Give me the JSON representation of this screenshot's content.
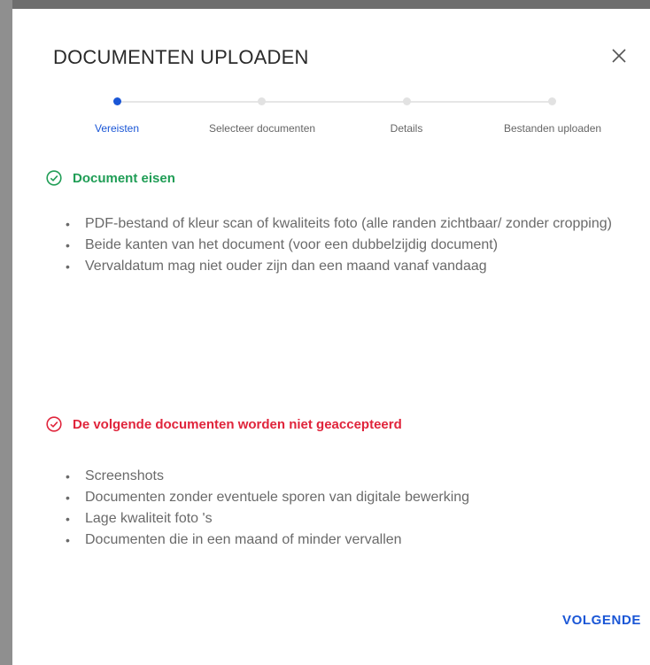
{
  "dialog": {
    "title": "DOCUMENTEN UPLOADEN",
    "close_icon": "close-icon"
  },
  "stepper": {
    "steps": [
      {
        "label": "Vereisten",
        "active": true
      },
      {
        "label": "Selecteer documenten",
        "active": false
      },
      {
        "label": "Details",
        "active": false
      },
      {
        "label": "Bestanden uploaden",
        "active": false
      }
    ]
  },
  "requirements": {
    "heading": "Document eisen",
    "icon": "check-circle-icon",
    "color": "#1f9d55",
    "items": [
      "PDF-bestand of kleur scan of kwaliteits foto (alle randen zichtbaar/ zonder cropping)",
      "Beide kanten van het document (voor een dubbelzijdig document)",
      "Vervaldatum mag niet ouder zijn dan een maand vanaf vandaag"
    ]
  },
  "rejected": {
    "heading": "De volgende documenten worden niet geaccepteerd",
    "icon": "cross-circle-icon",
    "color": "#e0243b",
    "items": [
      "Screenshots",
      "Documenten zonder eventuele sporen van digitale bewerking",
      "Lage kwaliteit foto 's",
      "Documenten die in een maand of minder vervallen"
    ]
  },
  "actions": {
    "next_label": "VOLGENDE"
  },
  "colors": {
    "accent": "#1a56d6"
  }
}
